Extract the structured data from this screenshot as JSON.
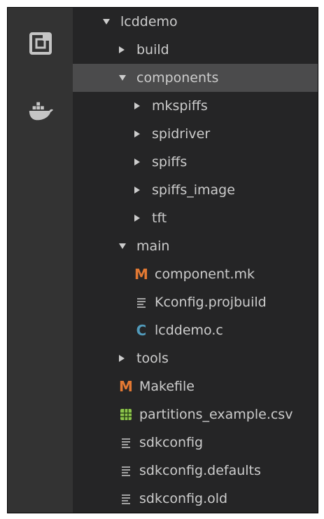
{
  "activity_bar": {
    "items": [
      {
        "icon": "explorer-icon"
      },
      {
        "icon": "docker-icon"
      }
    ]
  },
  "explorer": {
    "tree": [
      {
        "label": "lcddemo",
        "type": "folder",
        "expanded": true,
        "level": 0
      },
      {
        "label": "build",
        "type": "folder",
        "expanded": false,
        "level": 1
      },
      {
        "label": "components",
        "type": "folder",
        "expanded": true,
        "level": 1,
        "selected": true
      },
      {
        "label": "mkspiffs",
        "type": "folder",
        "expanded": false,
        "level": 2
      },
      {
        "label": "spidriver",
        "type": "folder",
        "expanded": false,
        "level": 2
      },
      {
        "label": "spiffs",
        "type": "folder",
        "expanded": false,
        "level": 2
      },
      {
        "label": "spiffs_image",
        "type": "folder",
        "expanded": false,
        "level": 2
      },
      {
        "label": "tft",
        "type": "folder",
        "expanded": false,
        "level": 2
      },
      {
        "label": "main",
        "type": "folder",
        "expanded": true,
        "level": 1
      },
      {
        "label": "component.mk",
        "type": "file",
        "icon": "makefile-icon",
        "level": 2
      },
      {
        "label": "Kconfig.projbuild",
        "type": "file",
        "icon": "text-file-icon",
        "level": 2
      },
      {
        "label": "lcddemo.c",
        "type": "file",
        "icon": "c-file-icon",
        "level": 2
      },
      {
        "label": "tools",
        "type": "folder",
        "expanded": false,
        "level": 1
      },
      {
        "label": "Makefile",
        "type": "file",
        "icon": "makefile-icon",
        "level": 1
      },
      {
        "label": "partitions_example.csv",
        "type": "file",
        "icon": "csv-file-icon",
        "level": 1
      },
      {
        "label": "sdkconfig",
        "type": "file",
        "icon": "text-file-icon",
        "level": 1
      },
      {
        "label": "sdkconfig.defaults",
        "type": "file",
        "icon": "text-file-icon",
        "level": 1
      },
      {
        "label": "sdkconfig.old",
        "type": "file",
        "icon": "text-file-icon",
        "level": 1
      }
    ]
  },
  "colors": {
    "sidebar_bg": "#252526",
    "activity_bar_bg": "#333333",
    "selected_row": "#4b4b4c",
    "makefile_icon": "#e37933",
    "c_file_icon": "#519aba",
    "csv_file_icon": "#8bc34a"
  }
}
